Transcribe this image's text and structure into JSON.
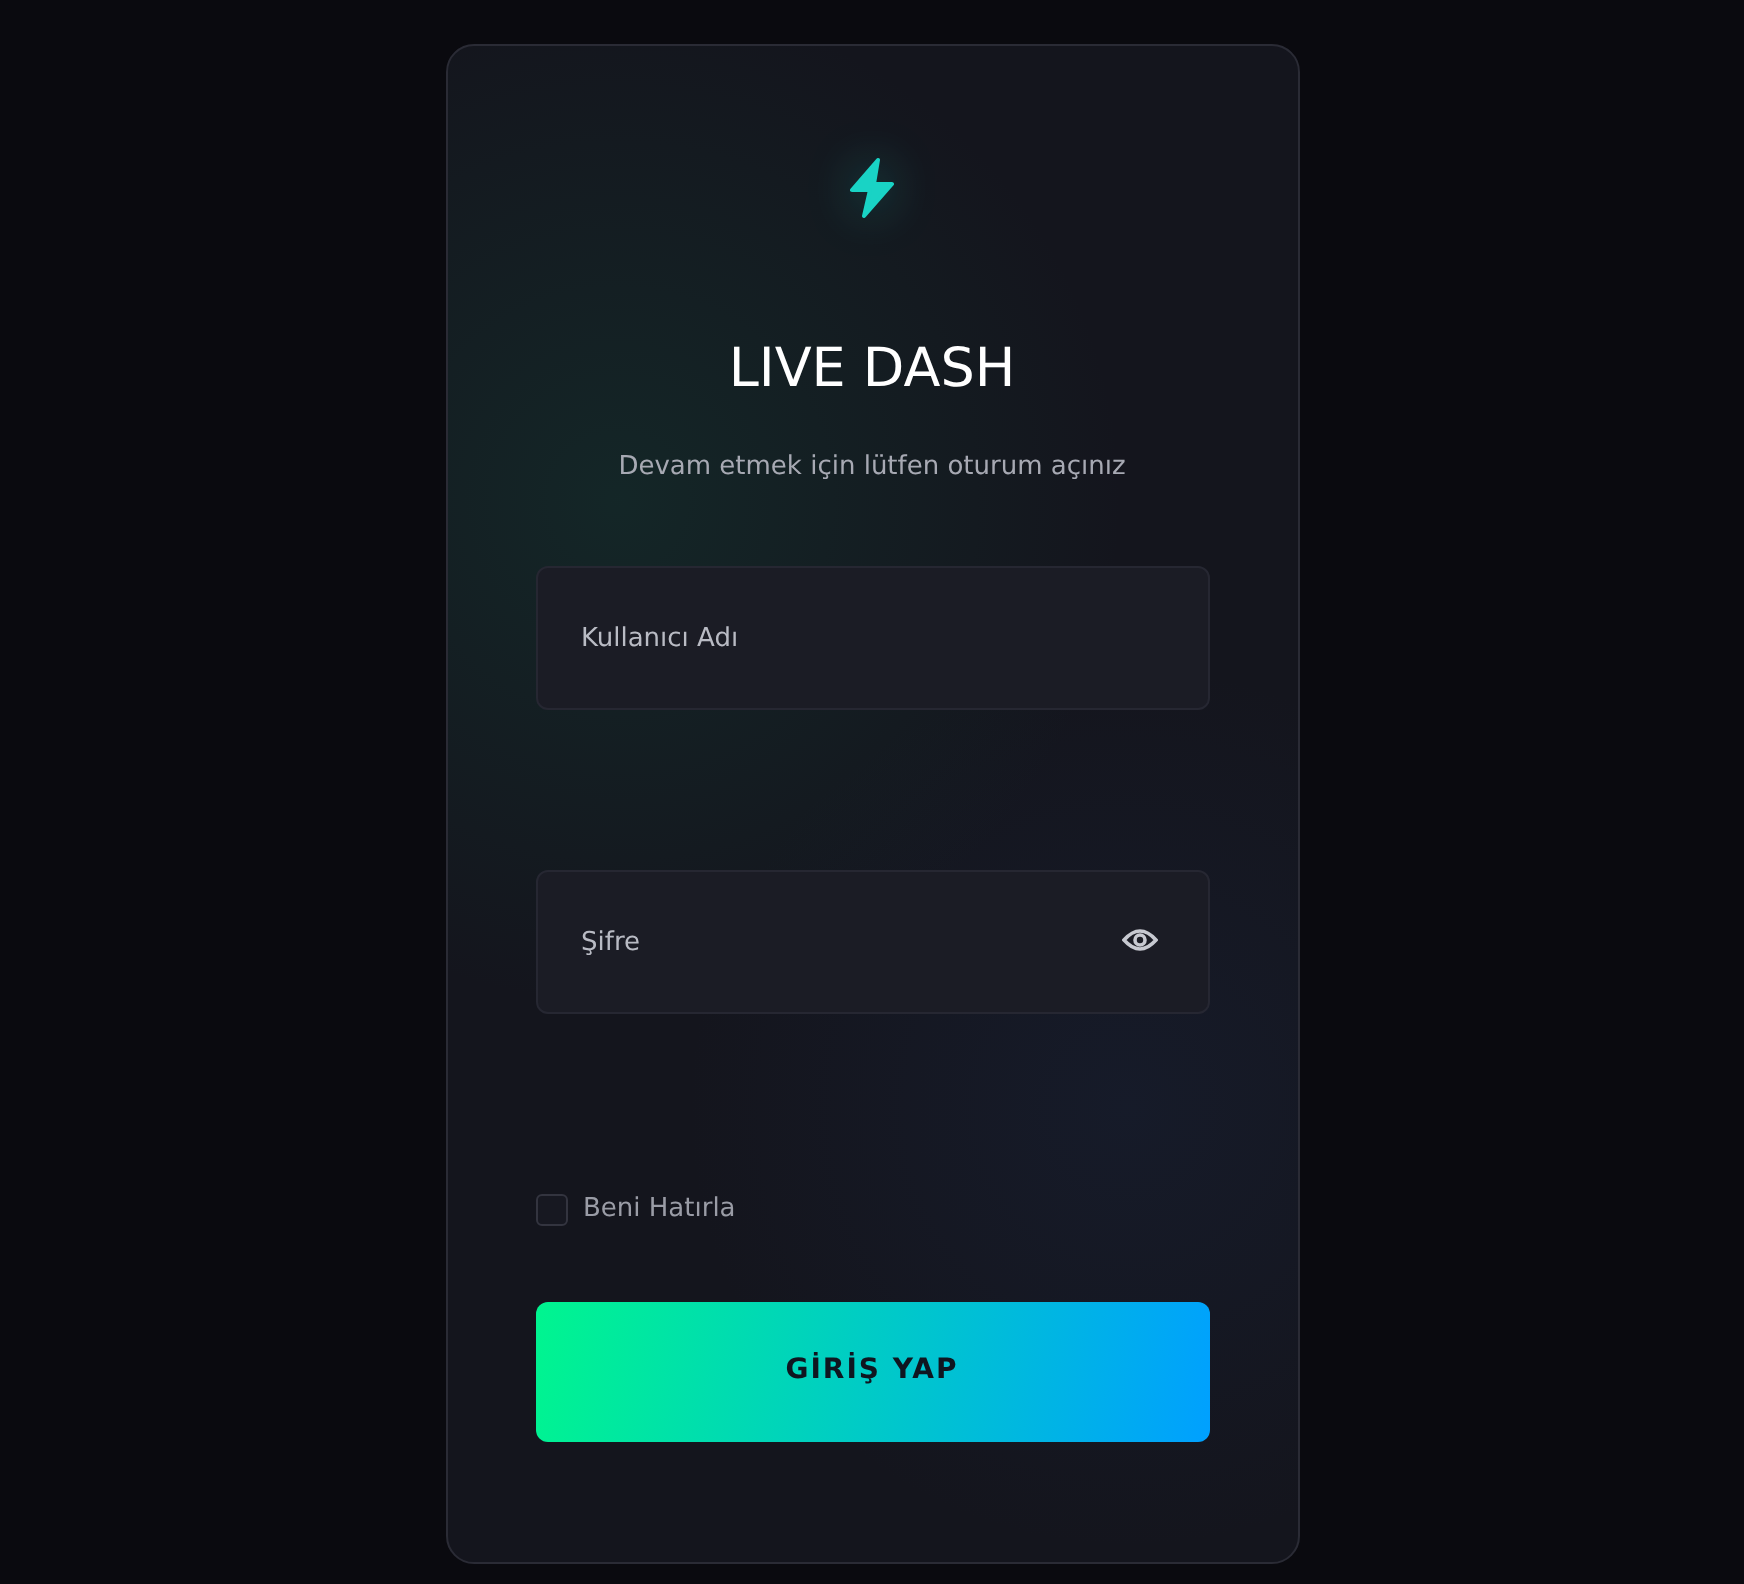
{
  "title": "LIVE DASH",
  "subtitle": "Devam etmek için lütfen oturum açınız",
  "fields": [
    {
      "kind": "text",
      "placeholder": "Kullanıcı Adı"
    },
    {
      "kind": "password",
      "placeholder": "Şifre"
    }
  ],
  "remember": {
    "label": "Beni Hatırla",
    "checked": false
  },
  "submit": {
    "label": "GİRİŞ YAP"
  }
}
